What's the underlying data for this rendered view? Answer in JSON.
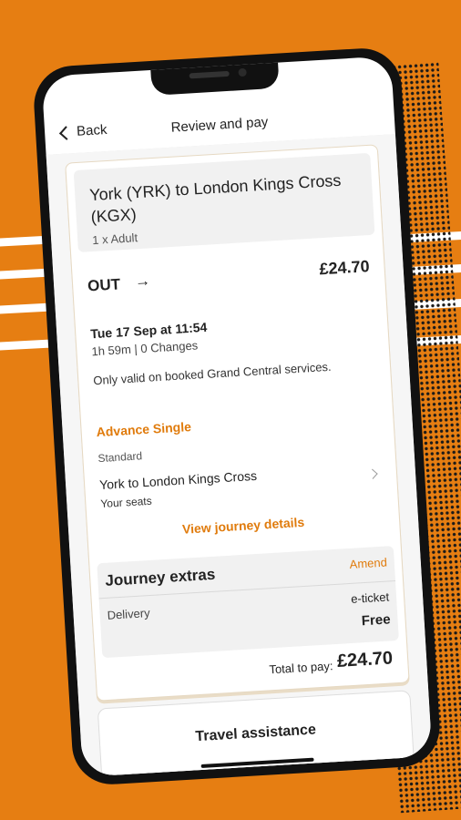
{
  "colors": {
    "background": "#e67e12",
    "accent": "#e07b0c"
  },
  "header": {
    "back_label": "Back",
    "title": "Review and pay"
  },
  "journey": {
    "route": "York (YRK) to London Kings Cross (KGX)",
    "passengers": "1 x Adult",
    "direction": "OUT",
    "direction_icon": "arrow-right-icon",
    "price": "£24.70",
    "date": "Tue 17 Sep at 11:54",
    "duration": "1h 59m | 0 Changes",
    "validity": "Only valid on booked Grand Central services.",
    "fare_type": "Advance Single",
    "travel_class": "Standard",
    "leg": "York to London Kings Cross",
    "seats_label": "Your seats",
    "view_details": "View journey details"
  },
  "extras": {
    "title": "Journey extras",
    "amend_label": "Amend",
    "delivery_label": "Delivery",
    "delivery_method": "e-ticket",
    "delivery_price": "Free"
  },
  "total": {
    "label": "Total to pay:",
    "value": "£24.70"
  },
  "assistance": {
    "label": "Travel assistance"
  }
}
